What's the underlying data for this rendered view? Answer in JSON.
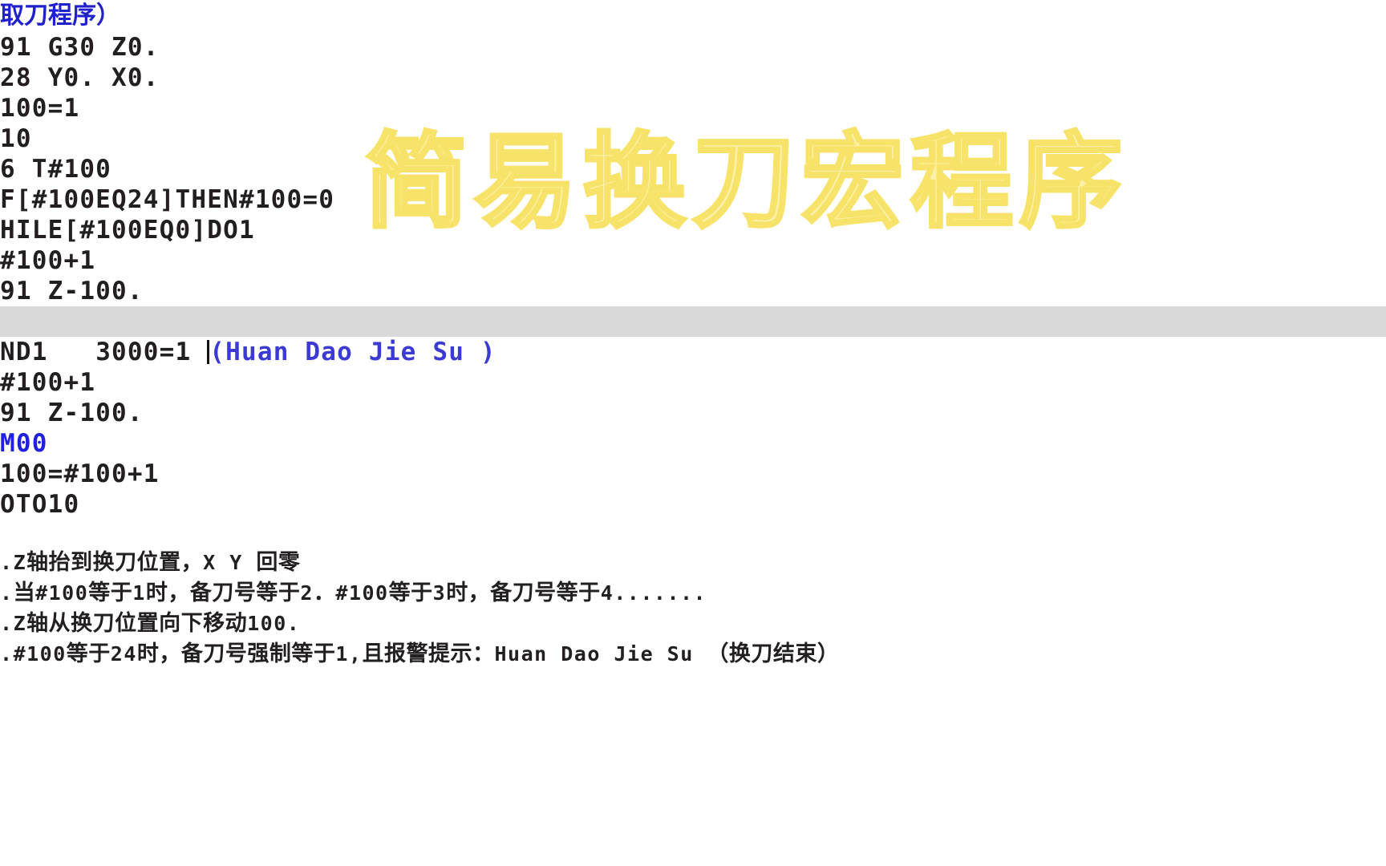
{
  "window": {
    "background_color": "#ffffff",
    "current_line_highlight_color": "#d9d9d9",
    "code_text_color": "#231f20",
    "comment_color": "#3b3bd4",
    "heading_color": "#2020cc",
    "watermark_fill_color": "#fdf0a8",
    "watermark_stroke_color": "#f8e36a"
  },
  "watermark": {
    "text": "简易换刀宏程序"
  },
  "editor": {
    "lines": [
      {
        "text": "取刀程序）",
        "style": "heading"
      },
      {
        "text": "91 G30 Z0.",
        "style": "plain"
      },
      {
        "text": "28 Y0. X0.",
        "style": "plain"
      },
      {
        "text": "100=1",
        "style": "plain"
      },
      {
        "text": "10",
        "style": "plain"
      },
      {
        "text": "6 T#100",
        "style": "plain"
      },
      {
        "text": "F[#100EQ24]THEN#100=0",
        "style": "plain"
      },
      {
        "text": "HILE[#100EQ0]DO1",
        "style": "plain"
      },
      {
        "text": "#100+1",
        "style": "plain"
      },
      {
        "text": "91 Z-100.",
        "style": "plain"
      },
      {
        "text": "3000=1 (Huan Dao Jie Su )",
        "style": "current",
        "prefix": "3000=1 ",
        "comment": "(Huan Dao Jie Su )",
        "caret_after_prefix_chars": 8
      },
      {
        "text": "ND1",
        "style": "plain"
      },
      {
        "text": "#100+1",
        "style": "plain"
      },
      {
        "text": "91 Z-100.",
        "style": "plain"
      },
      {
        "text": "M00",
        "style": "blue"
      },
      {
        "text": "100=#100+1",
        "style": "plain"
      },
      {
        "text": "OTO10",
        "style": "plain"
      }
    ]
  },
  "notes": {
    "lines": [
      {
        "segments": [
          {
            "text": ".",
            "mono": true
          },
          {
            "text": "Z",
            "mono": true
          },
          {
            "text": "轴抬到换刀位置，",
            "mono": false
          },
          {
            "text": "X Y ",
            "mono": true
          },
          {
            "text": "回零",
            "mono": false
          }
        ]
      },
      {
        "segments": [
          {
            "text": ".",
            "mono": true
          },
          {
            "text": "当",
            "mono": false
          },
          {
            "text": "#100",
            "mono": true
          },
          {
            "text": "等于",
            "mono": false
          },
          {
            "text": "1",
            "mono": true
          },
          {
            "text": "时，备刀号等于",
            "mono": false
          },
          {
            "text": "2",
            "mono": true
          },
          {
            "text": "．",
            "mono": false
          },
          {
            "text": "#100",
            "mono": true
          },
          {
            "text": "等于",
            "mono": false
          },
          {
            "text": "3",
            "mono": true
          },
          {
            "text": "时，备刀号等于",
            "mono": false
          },
          {
            "text": "4.......",
            "mono": true
          }
        ]
      },
      {
        "segments": [
          {
            "text": ".",
            "mono": true
          },
          {
            "text": "Z",
            "mono": true
          },
          {
            "text": "轴从换刀位置向下移动",
            "mono": false
          },
          {
            "text": "100.",
            "mono": true
          }
        ]
      },
      {
        "segments": [
          {
            "text": ".",
            "mono": true
          },
          {
            "text": "#100",
            "mono": true
          },
          {
            "text": "等于",
            "mono": false
          },
          {
            "text": "24",
            "mono": true
          },
          {
            "text": "时，备刀号强制等于",
            "mono": false
          },
          {
            "text": "1,",
            "mono": true
          },
          {
            "text": "且报警提示：",
            "mono": false
          },
          {
            "text": "Huan Dao Jie Su ",
            "mono": true
          },
          {
            "text": "（换刀结束）",
            "mono": false
          }
        ]
      }
    ]
  }
}
